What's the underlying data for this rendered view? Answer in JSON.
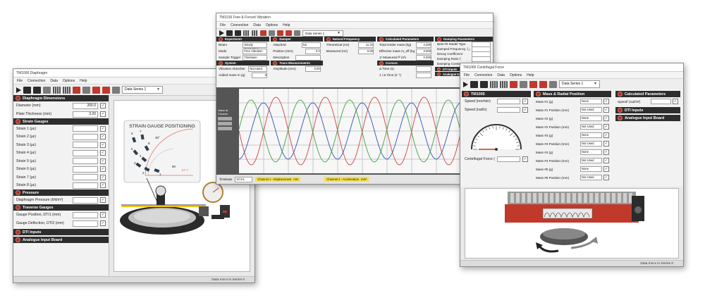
{
  "window_left": {
    "title": "TM1000 Diaphragm",
    "menu": [
      "File",
      "Connection",
      "Data",
      "Options",
      "Help"
    ],
    "data_series": "Data Series 1",
    "sections": {
      "diaphragm": {
        "title": "Diaphragm Dimensions",
        "rows": [
          {
            "label": "Diameter (mm)",
            "value": "200.0"
          },
          {
            "label": "Plate Thickness (mm)",
            "value": "3.20"
          }
        ]
      },
      "strain": {
        "title": "Strain Gauges",
        "rows": [
          "Strain 1 (µε)",
          "Strain 2 (µε)",
          "Strain 3 (µε)",
          "Strain 4 (µε)",
          "Strain 5 (µε)",
          "Strain 6 (µε)",
          "Strain 7 (µε)",
          "Strain 8 (µε)"
        ]
      },
      "pressure": {
        "title": "Pressure",
        "rows": [
          "Diaphragm Pressure (kN/m²)"
        ]
      },
      "traverse": {
        "title": "Traverse Gauges",
        "rows": [
          "Gauge Position, DTI1 (mm)",
          "Gauge Deflection, DTI2 (mm)"
        ]
      },
      "dti": {
        "title": "DTI Inputs"
      },
      "analogue": {
        "title": "Analogue Input Board"
      }
    },
    "strain_diagram": {
      "title": "STRAIN GAUGE POSITIONING",
      "labels": [
        "6",
        "7",
        "8",
        "5",
        "4",
        "3",
        "2",
        "1",
        "30°",
        "90",
        "67.7"
      ]
    },
    "status": "Data Invcv in Series 0"
  },
  "window_center": {
    "title": "TM1016 Free & Forced Vibration",
    "menu": [
      "File",
      "Connection",
      "Data",
      "Options",
      "Help"
    ],
    "data_series": "Data Series 1",
    "col1": {
      "experiment": {
        "title": "Experiment",
        "rows": [
          {
            "label": "Beam",
            "value": "Simply Supported"
          },
          {
            "label": "Mode",
            "value": "Free Vibration"
          },
          {
            "label": "Sample Trigger",
            "value": "Timebase"
          }
        ]
      },
      "system": {
        "title": "System",
        "rows": [
          {
            "label": "Vibration Absorber",
            "value": "Not Used"
          },
          {
            "label": "Added mass m (g)",
            "value": "0"
          }
        ]
      }
    },
    "col2": {
      "damper": {
        "title": "Damper",
        "rows": [
          {
            "label": "Attached",
            "value": "No"
          },
          {
            "label": "Position (mm)",
            "value": "0.0"
          },
          {
            "label": "Description",
            "value": ""
          }
        ]
      },
      "trace": {
        "title": "Trace Measurements",
        "rows": [
          {
            "label": "Amplitude (mm)",
            "value": "0.00"
          }
        ]
      }
    },
    "col3": {
      "natural": {
        "title": "Natural Frequency",
        "rows": [
          {
            "label": "Theoretical (Hz)",
            "value": "11.22"
          },
          {
            "label": "Measured (Hz)",
            "value": "0.00"
          }
        ]
      }
    },
    "col4": {
      "calc": {
        "title": "Calculated Parameters",
        "rows": [
          {
            "label": "Total Girder mass (kg)",
            "value": "4.200"
          },
          {
            "label": "Effective mass m_eff (kg)",
            "value": "3.000"
          },
          {
            "label": "1/ Measured f² (s²)",
            "value": "0.000"
          }
        ]
      },
      "cursors": {
        "title": "Cursors",
        "rows": [
          {
            "label": "Δ Time (s)",
            "value": ""
          },
          {
            "label": "1 / Δ Time (s⁻¹)",
            "value": ""
          }
        ]
      }
    },
    "col5": {
      "damping": {
        "title": "Damping Parameters",
        "rows": [
          "Best Fit Model Type",
          "Damped Frequency, f_d (Hz)",
          "Decay Coefficient",
          "Damping Ratio ζ",
          "Damping Constant c"
        ]
      },
      "dti": {
        "title": "DTI Inputs"
      },
      "analogue": {
        "title": "Analogue Input Board"
      }
    },
    "side_buttons": [
      "Value at Cursors"
    ],
    "bottom": {
      "timebase": "Timebase",
      "timebase_value": "10 ms",
      "channel1": "Channel 1 - Displacement",
      "channel1_unit": "mm",
      "channel2": "Channel 2 - Acceleration",
      "channel2_unit": "m/s²"
    }
  },
  "window_right": {
    "title": "TM1005 Centrifugal Force",
    "menu": [
      "File",
      "Connection",
      "Data",
      "Options",
      "Help"
    ],
    "data_series": "Data Series 1",
    "tm1005": {
      "title": "TM1005",
      "rows": [
        {
          "label": "Speed (rev/min)",
          "value": ""
        },
        {
          "label": "Speed (rad/s)",
          "value": ""
        }
      ],
      "force_label": "Centrifugal Force (N)"
    },
    "mass": {
      "title": "Mass & Radial Position",
      "rows": [
        {
          "label": "Mass #1 (g)",
          "value": "None"
        },
        {
          "label": "Mass #1 Position (mm)",
          "value": "Not Used"
        },
        {
          "label": "Mass #2 (g)",
          "value": "None"
        },
        {
          "label": "Mass #2 Position (mm)",
          "value": "Not Used"
        },
        {
          "label": "Mass #3 (g)",
          "value": "None"
        },
        {
          "label": "Mass #3 Position (mm)",
          "value": "Not Used"
        },
        {
          "label": "Mass #4 (g)",
          "value": "None"
        },
        {
          "label": "Mass #4 Position (mm)",
          "value": "Not Used"
        },
        {
          "label": "Mass #5 (g)",
          "value": "None"
        },
        {
          "label": "Mass #5 Position (mm)",
          "value": "Not Used"
        }
      ]
    },
    "calc": {
      "title": "Calculated Parameters",
      "rows": [
        {
          "label": "Speed² (rad²/s²)",
          "value": ""
        }
      ]
    },
    "dti": {
      "title": "DTI Inputs"
    },
    "analogue": {
      "title": "Analogue Input Board"
    },
    "status": "Data Invcv in Series 0"
  },
  "colors": {
    "section_header": "#2d2d2d",
    "accent_red": "#c0392b",
    "trace_red": "#d04040",
    "trace_blue": "#3050b0",
    "trace_green": "#40a040"
  }
}
